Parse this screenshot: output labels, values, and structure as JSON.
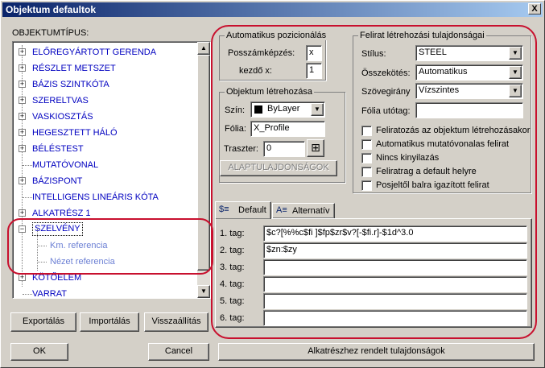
{
  "window": {
    "title": "Objektum defaultok",
    "close_symbol": "X"
  },
  "left_panel": {
    "label": "OBJEKTUMTÍPUS:",
    "tree_items": [
      {
        "label": "ELŐREGYÁRTOTT GERENDA",
        "expander": "+"
      },
      {
        "label": "RÉSZLET METSZET",
        "expander": "+"
      },
      {
        "label": "BÁZIS SZINTKÓTA",
        "expander": "+"
      },
      {
        "label": "SZERELTVAS",
        "expander": "+"
      },
      {
        "label": "VASKIOSZTÁS",
        "expander": "+"
      },
      {
        "label": "HEGESZTETT HÁLÓ",
        "expander": "+"
      },
      {
        "label": "BÉLÉSTEST",
        "expander": "+"
      },
      {
        "label": "MUTATÓVONAL",
        "expander": ""
      },
      {
        "label": "BÁZISPONT",
        "expander": "+"
      },
      {
        "label": "INTELLIGENS LINEÁRIS KÓTA",
        "expander": ""
      },
      {
        "label": "ALKATRÉSZ 1",
        "expander": "+"
      },
      {
        "label": "SZELVÉNY",
        "expander": "−"
      },
      {
        "label": "Km. referencia",
        "expander": ""
      },
      {
        "label": "Nézet referencia",
        "expander": ""
      },
      {
        "label": "KÖTŐELEM",
        "expander": "+"
      },
      {
        "label": "VARRAT",
        "expander": ""
      }
    ],
    "buttons": {
      "export": "Exportálás",
      "import": "Importálás",
      "restore": "Visszaállítás"
    }
  },
  "auto_position": {
    "title": "Automatikus pozicionálás",
    "post_trace_label": "Posszámképzés:",
    "post_trace_value": "x",
    "start_x_label": "kezdő x:",
    "start_x_value": "1"
  },
  "object_creation": {
    "title": "Objektum létrehozása",
    "color_label": "Szín:",
    "color_value": "ByLayer",
    "foil_label": "Fólia:",
    "foil_value": "X_Profile",
    "raster_label": "Traszter:",
    "raster_value": "0",
    "base_props_button": "ALAPTULAJDONSÁGOK"
  },
  "label_props": {
    "title": "Felirat létrehozási tulajdonságai",
    "style_label": "Stílus:",
    "style_value": "STEEL",
    "join_label": "Összekötés:",
    "join_value": "Automatikus",
    "direction_label": "Szövegirány",
    "direction_value": "Vízszintes",
    "foil_suffix_label": "Fólia utótag:",
    "foil_suffix_value": "",
    "checkboxes": [
      "Feliratozás az objektum létrehozásakor",
      "Automatikus mutatóvonalas felirat",
      "Nincs kinyilazás",
      "Feliratrag a default helyre",
      "Posjeltől balra igazított felirat"
    ]
  },
  "tabs": [
    {
      "label": "Default"
    },
    {
      "label": "Alternatív"
    }
  ],
  "tags": [
    {
      "label": "1. tag:",
      "value": "$c?[%%c$fi ]$fp$zr$v?[-$fi.r]-$1d^3.0"
    },
    {
      "label": "2. tag:",
      "value": "$zn:$zy"
    },
    {
      "label": "3. tag:",
      "value": ""
    },
    {
      "label": "4. tag:",
      "value": ""
    },
    {
      "label": "5. tag:",
      "value": ""
    },
    {
      "label": "6. tag:",
      "value": ""
    }
  ],
  "footer": {
    "ok": "OK",
    "cancel": "Cancel",
    "part_props": "Alkatrészhez rendelt tulajdonságok"
  },
  "colors": {
    "highlight_outline": "#c8102e",
    "tree_text": "#0000c0",
    "selection": "#0a246a"
  }
}
